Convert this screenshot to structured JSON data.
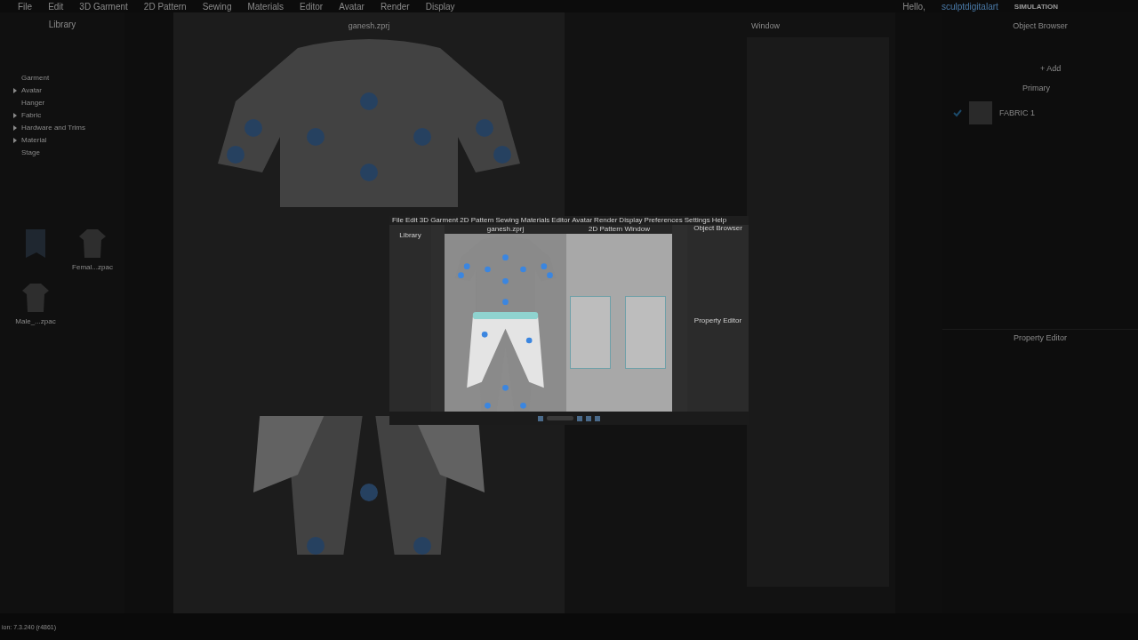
{
  "background": {
    "menu": [
      "File",
      "Edit",
      "3D Garment",
      "2D Pattern",
      "Sewing",
      "Materials",
      "Editor",
      "Avatar",
      "Render",
      "Display"
    ],
    "greeting": "Hello,",
    "user": "sculptdigitalart",
    "mode": "SIMULATION",
    "library": {
      "title": "Library",
      "tree": [
        {
          "label": "Garment",
          "expandable": false
        },
        {
          "label": "Avatar",
          "expandable": true
        },
        {
          "label": "Hanger",
          "expandable": false
        },
        {
          "label": "Fabric",
          "expandable": true
        },
        {
          "label": "Hardware and Trims",
          "expandable": true
        },
        {
          "label": "Material",
          "expandable": true
        },
        {
          "label": "Stage",
          "expandable": false
        }
      ],
      "files": [
        {
          "kind": "folder"
        },
        {
          "kind": "shirt",
          "label": "Femal...zpac"
        },
        {
          "kind": "shirt",
          "label": "Male_...zpac"
        }
      ]
    },
    "viewport_title": "ganesh.zprj",
    "pattern_window_title": "Window",
    "object_browser": {
      "title": "Object Browser",
      "add": "+ Add",
      "section": "Primary",
      "fabrics": [
        {
          "name": "FABRIC 1",
          "checked": true
        }
      ]
    },
    "property_editor": {
      "title": "Property Editor"
    },
    "status": "ion: 7.3.240 (r4861)"
  },
  "inset": {
    "menu": [
      "File",
      "Edit",
      "3D Garment",
      "2D Pattern",
      "Sewing",
      "Materials",
      "Editor",
      "Avatar",
      "Render",
      "Display",
      "Preferences",
      "Settings",
      "Help"
    ],
    "library_title": "Library",
    "viewport_title": "ganesh.zprj",
    "pattern_window_title": "2D Pattern Window",
    "object_browser_title": "Object Browser",
    "property_editor_title": "Property Editor"
  }
}
